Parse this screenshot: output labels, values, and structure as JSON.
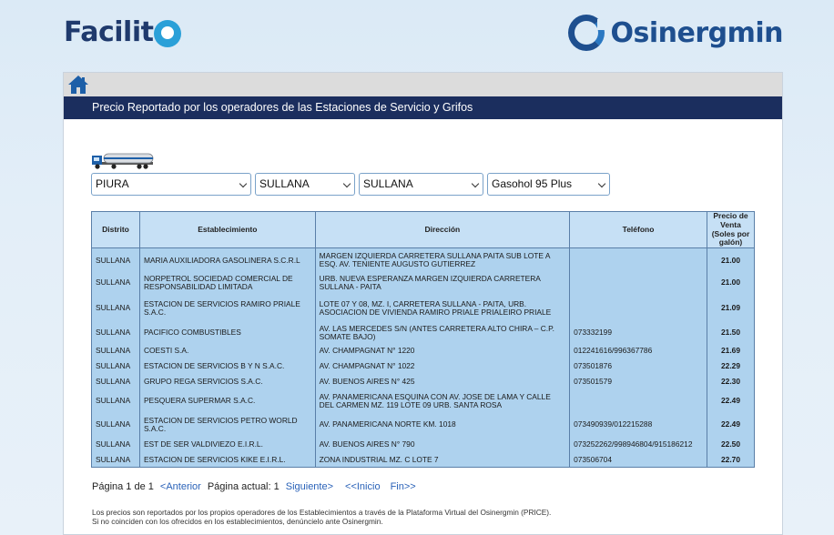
{
  "header": {
    "facilito_logo_text": "Facilit",
    "osinergmin_logo_text": "Osinergmin"
  },
  "panel": {
    "title": "Precio Reportado por los operadores de las Estaciones de Servicio y Grifos"
  },
  "filters": {
    "departamento": "PIURA",
    "provincia": "SULLANA",
    "distrito": "SULLANA",
    "producto": "Gasohol 95 Plus"
  },
  "table": {
    "headers": {
      "distrito": "Distrito",
      "establecimiento": "Establecimiento",
      "direccion": "Dirección",
      "telefono": "Teléfono",
      "precio_l1": "Precio de",
      "precio_l2": "Venta",
      "precio_l3": "(Soles por",
      "precio_l4": "galón)"
    },
    "rows": [
      {
        "distrito": "SULLANA",
        "establecimiento": "MARIA AUXILIADORA GASOLINERA S.C.R.L",
        "direccion": "MARGEN IZQUIERDA CARRETERA SULLANA PAITA SUB LOTE A ESQ. AV. TENIENTE AUGUSTO GUTIERREZ",
        "telefono": "",
        "precio": "21.00"
      },
      {
        "distrito": "SULLANA",
        "establecimiento": "NORPETROL SOCIEDAD COMERCIAL DE RESPONSABILIDAD LIMITADA",
        "direccion": "URB. NUEVA ESPERANZA MARGEN IZQUIERDA CARRETERA SULLANA - PAITA",
        "telefono": "",
        "precio": "21.00"
      },
      {
        "distrito": "SULLANA",
        "establecimiento": "ESTACION DE SERVICIOS RAMIRO PRIALE S.A.C.",
        "direccion": "LOTE 07 Y 08, MZ. I, CARRETERA SULLANA - PAITA, URB. ASOCIACION DE VIVIENDA RAMIRO PRIALE PRIALEIRO PRIALE",
        "telefono": "",
        "precio": "21.09"
      },
      {
        "distrito": "SULLANA",
        "establecimiento": "PACIFICO COMBUSTIBLES",
        "direccion": "AV. LAS MERCEDES S/N (ANTES CARRETERA ALTO CHIRA – C.P. SOMATE BAJO)",
        "telefono": "073332199",
        "precio": "21.50"
      },
      {
        "distrito": "SULLANA",
        "establecimiento": "COESTI S.A.",
        "direccion": "AV. CHAMPAGNAT N° 1220",
        "telefono": "012241616/996367786",
        "precio": "21.69"
      },
      {
        "distrito": "SULLANA",
        "establecimiento": "ESTACION DE SERVICIOS B Y N S.A.C.",
        "direccion": "AV. CHAMPAGNAT N° 1022",
        "telefono": "073501876",
        "precio": "22.29"
      },
      {
        "distrito": "SULLANA",
        "establecimiento": "GRUPO REGA SERVICIOS S.A.C.",
        "direccion": "AV. BUENOS AIRES N° 425",
        "telefono": "073501579",
        "precio": "22.30"
      },
      {
        "distrito": "SULLANA",
        "establecimiento": "PESQUERA SUPERMAR S.A.C.",
        "direccion": "AV. PANAMERICANA ESQUINA CON AV. JOSE DE LAMA Y CALLE DEL CARMEN MZ. 119 LOTE 09 URB. SANTA ROSA",
        "telefono": "",
        "precio": "22.49"
      },
      {
        "distrito": "SULLANA",
        "establecimiento": "ESTACION DE SERVICIOS PETRO WORLD S.A.C.",
        "direccion": "AV. PANAMERICANA NORTE KM. 1018",
        "telefono": "073490939/012215288",
        "precio": "22.49"
      },
      {
        "distrito": "SULLANA",
        "establecimiento": "EST DE SER VALDIVIEZO E.I.R.L.",
        "direccion": "AV. BUENOS AIRES N° 790",
        "telefono": "073252262/998946804/915186212",
        "precio": "22.50"
      },
      {
        "distrito": "SULLANA",
        "establecimiento": "ESTACION DE SERVICIOS KIKE E.I.R.L.",
        "direccion": "ZONA INDUSTRIAL MZ. C LOTE 7",
        "telefono": "073506704",
        "precio": "22.70"
      }
    ]
  },
  "pager": {
    "page_info": "Página 1 de 1",
    "anterior": "<Anterior",
    "actual": "Página actual: 1",
    "siguiente": "Siguiente>",
    "inicio": "<<Inicio",
    "fin": "Fin>>"
  },
  "footnote": {
    "line1": "Los precios son reportados por los propios operadores de los Establecimientos a través de la Plataforma Virtual del Osinergmin (PRICE).",
    "line2": "Si no coinciden con los ofrecidos en los establecimientos, denúncielo ante Osinergmin."
  },
  "colors": {
    "navy": "#1b2e5e",
    "table_row": "#aed2ee",
    "table_header": "#c6e0f5",
    "link": "#2a62b8"
  }
}
